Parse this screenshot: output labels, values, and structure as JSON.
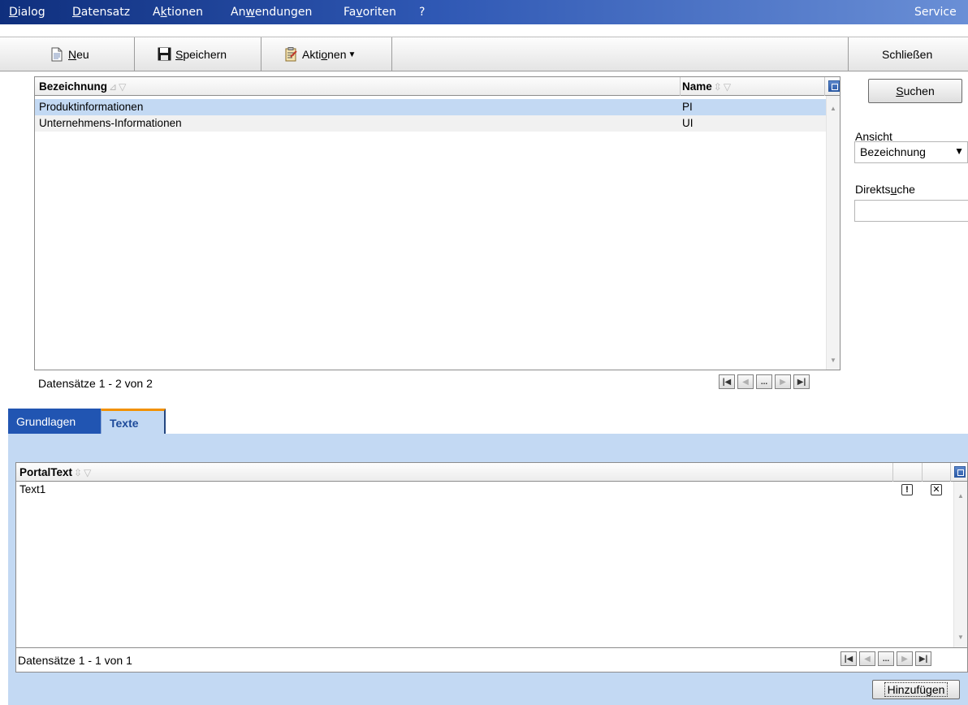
{
  "menubar": {
    "items": [
      {
        "pre": "",
        "accel": "D",
        "post": "ialog"
      },
      {
        "pre": "",
        "accel": "D",
        "post": "atensatz"
      },
      {
        "pre": "A",
        "accel": "k",
        "post": "tionen"
      },
      {
        "pre": "An",
        "accel": "w",
        "post": "endungen"
      },
      {
        "pre": "Fa",
        "accel": "v",
        "post": "oriten"
      },
      {
        "pre": "",
        "accel": "",
        "post": "?"
      }
    ],
    "right_label": "Service"
  },
  "toolbar": {
    "new": {
      "accel": "N",
      "post": "eu",
      "icon": "new-document-icon"
    },
    "save": {
      "pre": "",
      "accel": "S",
      "post": "peichern",
      "icon": "floppy-disk-icon"
    },
    "actions": {
      "pre": "Akti",
      "accel": "o",
      "post": "nen",
      "icon": "clipboard-icon"
    },
    "close_label": "Schließen"
  },
  "main_grid": {
    "columns": [
      "Bezeichnung",
      "Name"
    ],
    "rows": [
      {
        "bezeichnung": "Produktinformationen",
        "name": "PI",
        "selected": true
      },
      {
        "bezeichnung": "Unternehmens-Informationen",
        "name": "UI",
        "selected": false
      }
    ],
    "record_count": "Datensätze 1 - 2 von 2",
    "pager_ellipsis": "..."
  },
  "search_panel": {
    "search_button": {
      "accel": "S",
      "post": "uchen"
    },
    "view_label": "Ansicht",
    "view_value": "Bezeichnung",
    "direct_search": {
      "pre": "Direkts",
      "accel": "u",
      "post": "che"
    },
    "direct_search_value": ""
  },
  "tabs": [
    {
      "label": "Grundlagen",
      "active": false
    },
    {
      "label": "Texte",
      "active": true
    }
  ],
  "text_grid": {
    "column": "PortalText",
    "rows": [
      {
        "text": "Text1"
      }
    ],
    "record_count": "Datensätze 1 - 1 von 1",
    "pager_ellipsis": "...",
    "add_button": "Hinzufügen"
  },
  "colors": {
    "selection": "#c3d9f3",
    "tab_active_bg": "#c3d9f3",
    "tab_inactive_bg": "#2155b2",
    "accent_orange": "#f29100"
  }
}
